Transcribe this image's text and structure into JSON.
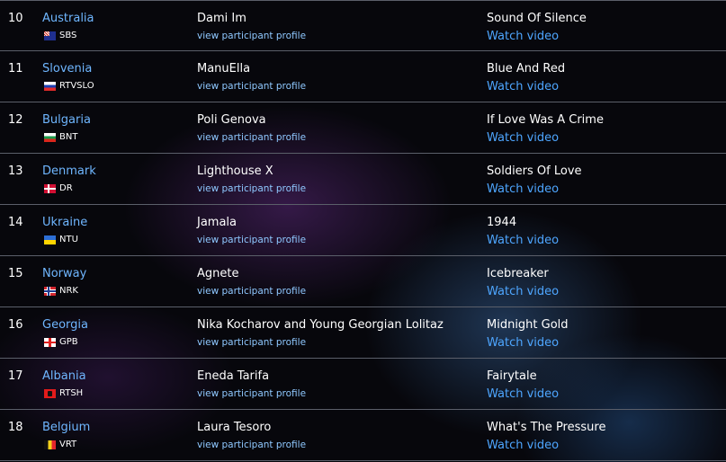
{
  "rows": [
    {
      "num": "10",
      "country": "Australia",
      "broadcaster": "SBS",
      "flag": "australia-flag-icon",
      "artist": "Dami Im",
      "profile": "view participant profile",
      "song": "Sound Of Silence",
      "watch": "Watch video"
    },
    {
      "num": "11",
      "country": "Slovenia",
      "broadcaster": "RTVSLO",
      "flag": "slovenia-flag-icon",
      "artist": "ManuElla",
      "profile": "view participant profile",
      "song": "Blue And Red",
      "watch": "Watch video"
    },
    {
      "num": "12",
      "country": "Bulgaria",
      "broadcaster": "BNT",
      "flag": "bulgaria-flag-icon",
      "artist": "Poli Genova",
      "profile": "view participant profile",
      "song": "If Love Was A Crime",
      "watch": "Watch video"
    },
    {
      "num": "13",
      "country": "Denmark",
      "broadcaster": "DR",
      "flag": "denmark-flag-icon",
      "artist": "Lighthouse X",
      "profile": "view participant profile",
      "song": "Soldiers Of Love",
      "watch": "Watch video"
    },
    {
      "num": "14",
      "country": "Ukraine",
      "broadcaster": "NTU",
      "flag": "ukraine-flag-icon",
      "artist": "Jamala",
      "profile": "view participant profile",
      "song": "1944",
      "watch": "Watch video"
    },
    {
      "num": "15",
      "country": "Norway",
      "broadcaster": "NRK",
      "flag": "norway-flag-icon",
      "artist": "Agnete",
      "profile": "view participant profile",
      "song": "Icebreaker",
      "watch": "Watch video"
    },
    {
      "num": "16",
      "country": "Georgia",
      "broadcaster": "GPB",
      "flag": "georgia-flag-icon",
      "artist": "Nika Kocharov and Young Georgian Lolitaz",
      "profile": "view participant profile",
      "song": "Midnight Gold",
      "watch": "Watch video"
    },
    {
      "num": "17",
      "country": "Albania",
      "broadcaster": "RTSH",
      "flag": "albania-flag-icon",
      "artist": "Eneda Tarifa",
      "profile": "view participant profile",
      "song": "Fairytale",
      "watch": "Watch video"
    },
    {
      "num": "18",
      "country": "Belgium",
      "broadcaster": "VRT",
      "flag": "belgium-flag-icon",
      "artist": "Laura Tesoro",
      "profile": "view participant profile",
      "song": "What's The Pressure",
      "watch": "Watch video"
    }
  ]
}
